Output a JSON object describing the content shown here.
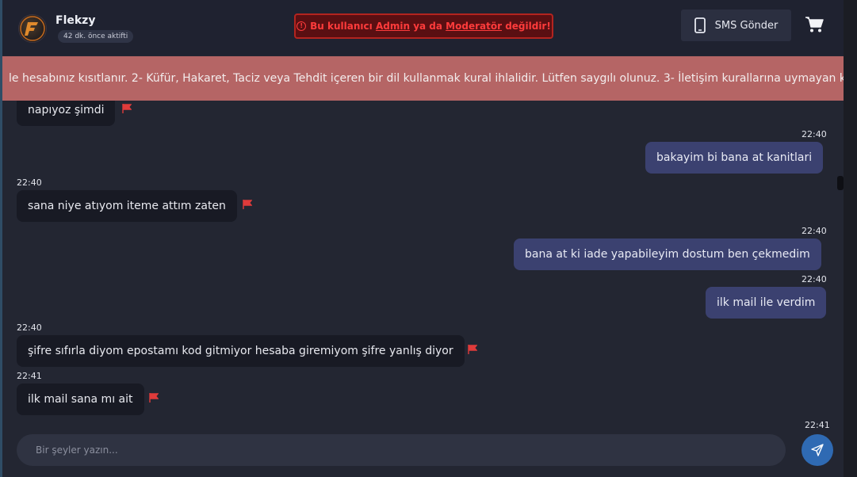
{
  "header": {
    "user_name": "Flekzy",
    "user_status": "42 dk. önce aktifti",
    "warning": {
      "prefix": "Bu kullanıcı",
      "admin_link": "Admin",
      "middle": "ya da",
      "moderator_link": "Moderatör",
      "suffix": "değildir!"
    },
    "sms_label": "SMS Gönder"
  },
  "rules_banner": "le hesabınız kısıtlanır. 2- Küfür, Hakaret, Taciz veya Tehdit içeren bir dil kullanmak kural ihlalidir. Lütfen saygılı olunuz. 3- İletişim kurallarına uymayan ku",
  "messages": [
    {
      "direction": "in",
      "time": "",
      "text": "napıyoz şimdi"
    },
    {
      "direction": "out",
      "time": "22:40",
      "text": "bakayim bi bana at kanitlari"
    },
    {
      "direction": "in",
      "time": "22:40",
      "text": "sana niye atıyom iteme attım zaten"
    },
    {
      "direction": "out",
      "time": "22:40",
      "text": "bana at ki iade yapabileyim dostum ben çekmedim"
    },
    {
      "direction": "out",
      "time": "22:40",
      "text": "ilk mail ile verdim"
    },
    {
      "direction": "in",
      "time": "22:40",
      "text": "şifre sıfırla diyom epostamı kod gitmiyor hesaba giremiyom şifre yanlış diyor"
    },
    {
      "direction": "in",
      "time": "22:41",
      "text": "ilk mail sana mı ait"
    },
    {
      "direction": "out",
      "time": "22:41",
      "text": ""
    }
  ],
  "composer": {
    "placeholder": "Bir şeyler yazın..."
  },
  "colors": {
    "accent": "#2f6ab3",
    "banner": "#b56565",
    "warning": "#ff3b3b",
    "flag": "#e03b3b"
  }
}
